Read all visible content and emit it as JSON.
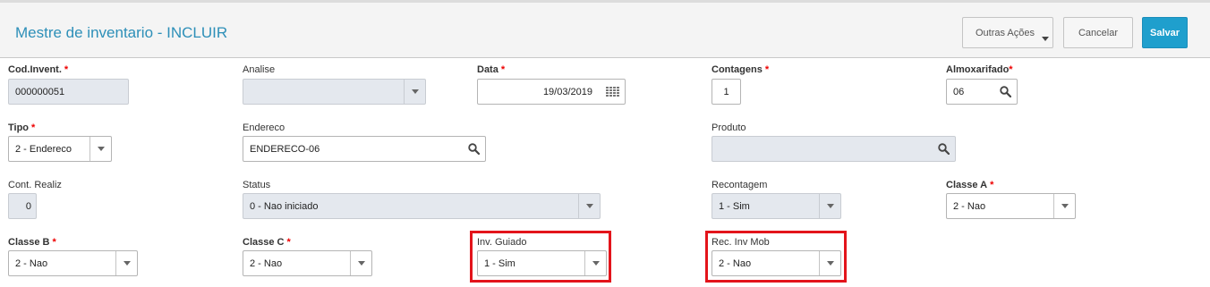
{
  "header": {
    "title": "Mestre de inventario - INCLUIR",
    "buttons": {
      "outras_acoes": "Outras Ações",
      "cancelar": "Cancelar",
      "salvar": "Salvar"
    }
  },
  "form": {
    "cod_invent": {
      "label": "Cod.Invent.",
      "value": "000000051"
    },
    "analise": {
      "label": "Analise",
      "value": ""
    },
    "data": {
      "label": "Data",
      "value": "19/03/2019"
    },
    "contagens": {
      "label": "Contagens",
      "value": "1"
    },
    "almoxarifado": {
      "label": "Almoxarifado",
      "value": "06"
    },
    "tipo": {
      "label": "Tipo",
      "value": "2 - Endereco"
    },
    "endereco": {
      "label": "Endereco",
      "value": "ENDERECO-06"
    },
    "produto": {
      "label": "Produto",
      "value": ""
    },
    "cont_realiz": {
      "label": "Cont. Realiz",
      "value": "0"
    },
    "status": {
      "label": "Status",
      "value": "0 - Nao iniciado"
    },
    "recontagem": {
      "label": "Recontagem",
      "value": "1 - Sim"
    },
    "classe_a": {
      "label": "Classe A",
      "value": "2 - Nao"
    },
    "classe_b": {
      "label": "Classe B",
      "value": "2 - Nao"
    },
    "classe_c": {
      "label": "Classe C",
      "value": "2 - Nao"
    },
    "inv_guiado": {
      "label": "Inv. Guiado",
      "value": "1 - Sim"
    },
    "rec_inv_mob": {
      "label": "Rec. Inv Mob",
      "value": "2 - Nao"
    }
  },
  "required_marker": "*",
  "colors": {
    "title": "#2d8fb8",
    "primary_button": "#1f9fcd",
    "highlight": "#e3141b",
    "required": "#e00000",
    "readonly_field": "#e4e8ee"
  },
  "icons": {
    "search": "search-icon",
    "calendar": "calendar-icon",
    "dropdown": "chevron-down-icon"
  }
}
